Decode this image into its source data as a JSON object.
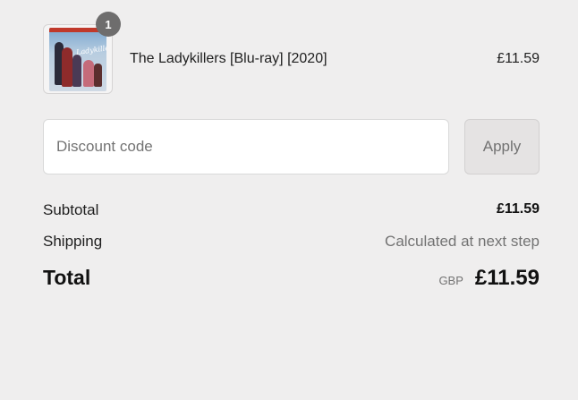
{
  "line_item": {
    "quantity": "1",
    "name": "The Ladykillers [Blu-ray] [2020]",
    "price": "£11.59",
    "cover_text": "Ladykillers"
  },
  "discount": {
    "placeholder": "Discount code",
    "value": "",
    "apply_label": "Apply"
  },
  "summary": {
    "subtotal_label": "Subtotal",
    "subtotal_value": "£11.59",
    "shipping_label": "Shipping",
    "shipping_value": "Calculated at next step",
    "total_label": "Total",
    "currency": "GBP",
    "total_value": "£11.59"
  },
  "colors": {
    "background": "#efeeee",
    "badge": "#6e6d6d",
    "button_bg": "#e5e3e3",
    "muted_text": "#737373"
  }
}
